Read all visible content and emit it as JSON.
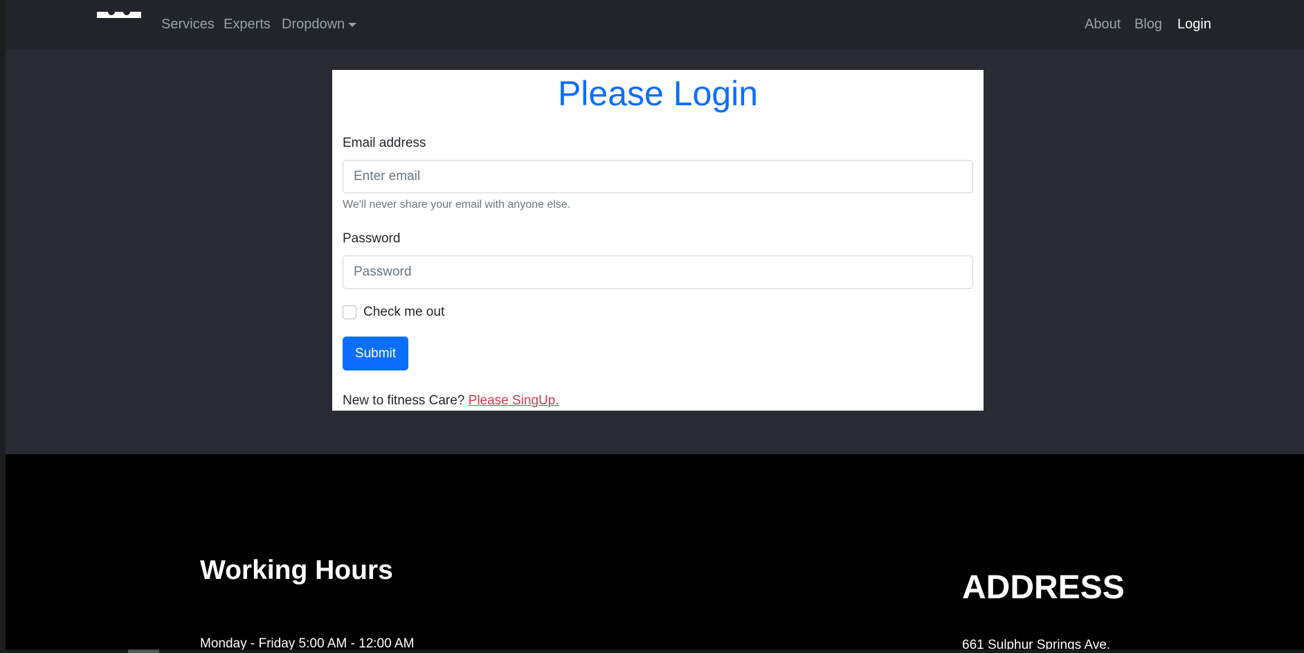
{
  "nav": {
    "brand_name": "brand-logo",
    "left_items": [
      {
        "label": "Services"
      },
      {
        "label": "Experts"
      },
      {
        "label": "Dropdown"
      }
    ],
    "right_items": [
      {
        "label": "About"
      },
      {
        "label": "Blog"
      },
      {
        "label": "Login"
      }
    ],
    "active_item": "Login"
  },
  "login": {
    "title": "Please Login",
    "email_label": "Email address",
    "email_placeholder": "Enter email",
    "email_help": "We'll never share your email with anyone else.",
    "password_label": "Password",
    "password_placeholder": "Password",
    "checkbox_label": "Check me out",
    "checkbox_checked": false,
    "submit_label": "Submit",
    "signup_prompt": "New to fitness Care?",
    "signup_link": "Please SingUp."
  },
  "footer": {
    "hours_title": "Working Hours",
    "hours_line": "Monday - Friday 5:00 AM - 12:00 AM",
    "address_title": "ADDRESS",
    "address_line": "661 Sulphur Springs Ave."
  },
  "colors": {
    "primary": "#0d6efd",
    "danger": "#dc3545",
    "navbar": "#212529",
    "page_bg": "#282b33",
    "footer_bg": "#000000"
  }
}
